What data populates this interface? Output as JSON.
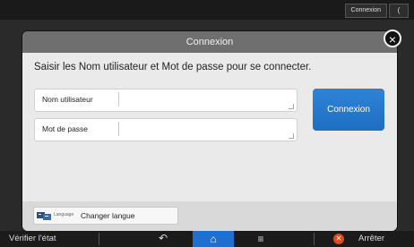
{
  "top_bar": {
    "login_button_label": "Connexion",
    "extra_button_label": "("
  },
  "dialog": {
    "title": "Connexion",
    "instruction": "Saisir les Nom utilisateur et Mot de passe pour se connecter.",
    "username_label": "Nom utilisateur",
    "username_value": "",
    "password_label": "Mot de passe",
    "password_value": "",
    "login_button_label": "Connexion",
    "language_small_label": "Language",
    "language_button_label": "Changer langue"
  },
  "bottom_bar": {
    "verify_label": "Vérifier l'état",
    "stop_label": "Arrêter"
  },
  "colors": {
    "accent_blue": "#1f6fd0",
    "stop_orange": "#e34a1b",
    "dialog_header": "#6f6f6f"
  }
}
